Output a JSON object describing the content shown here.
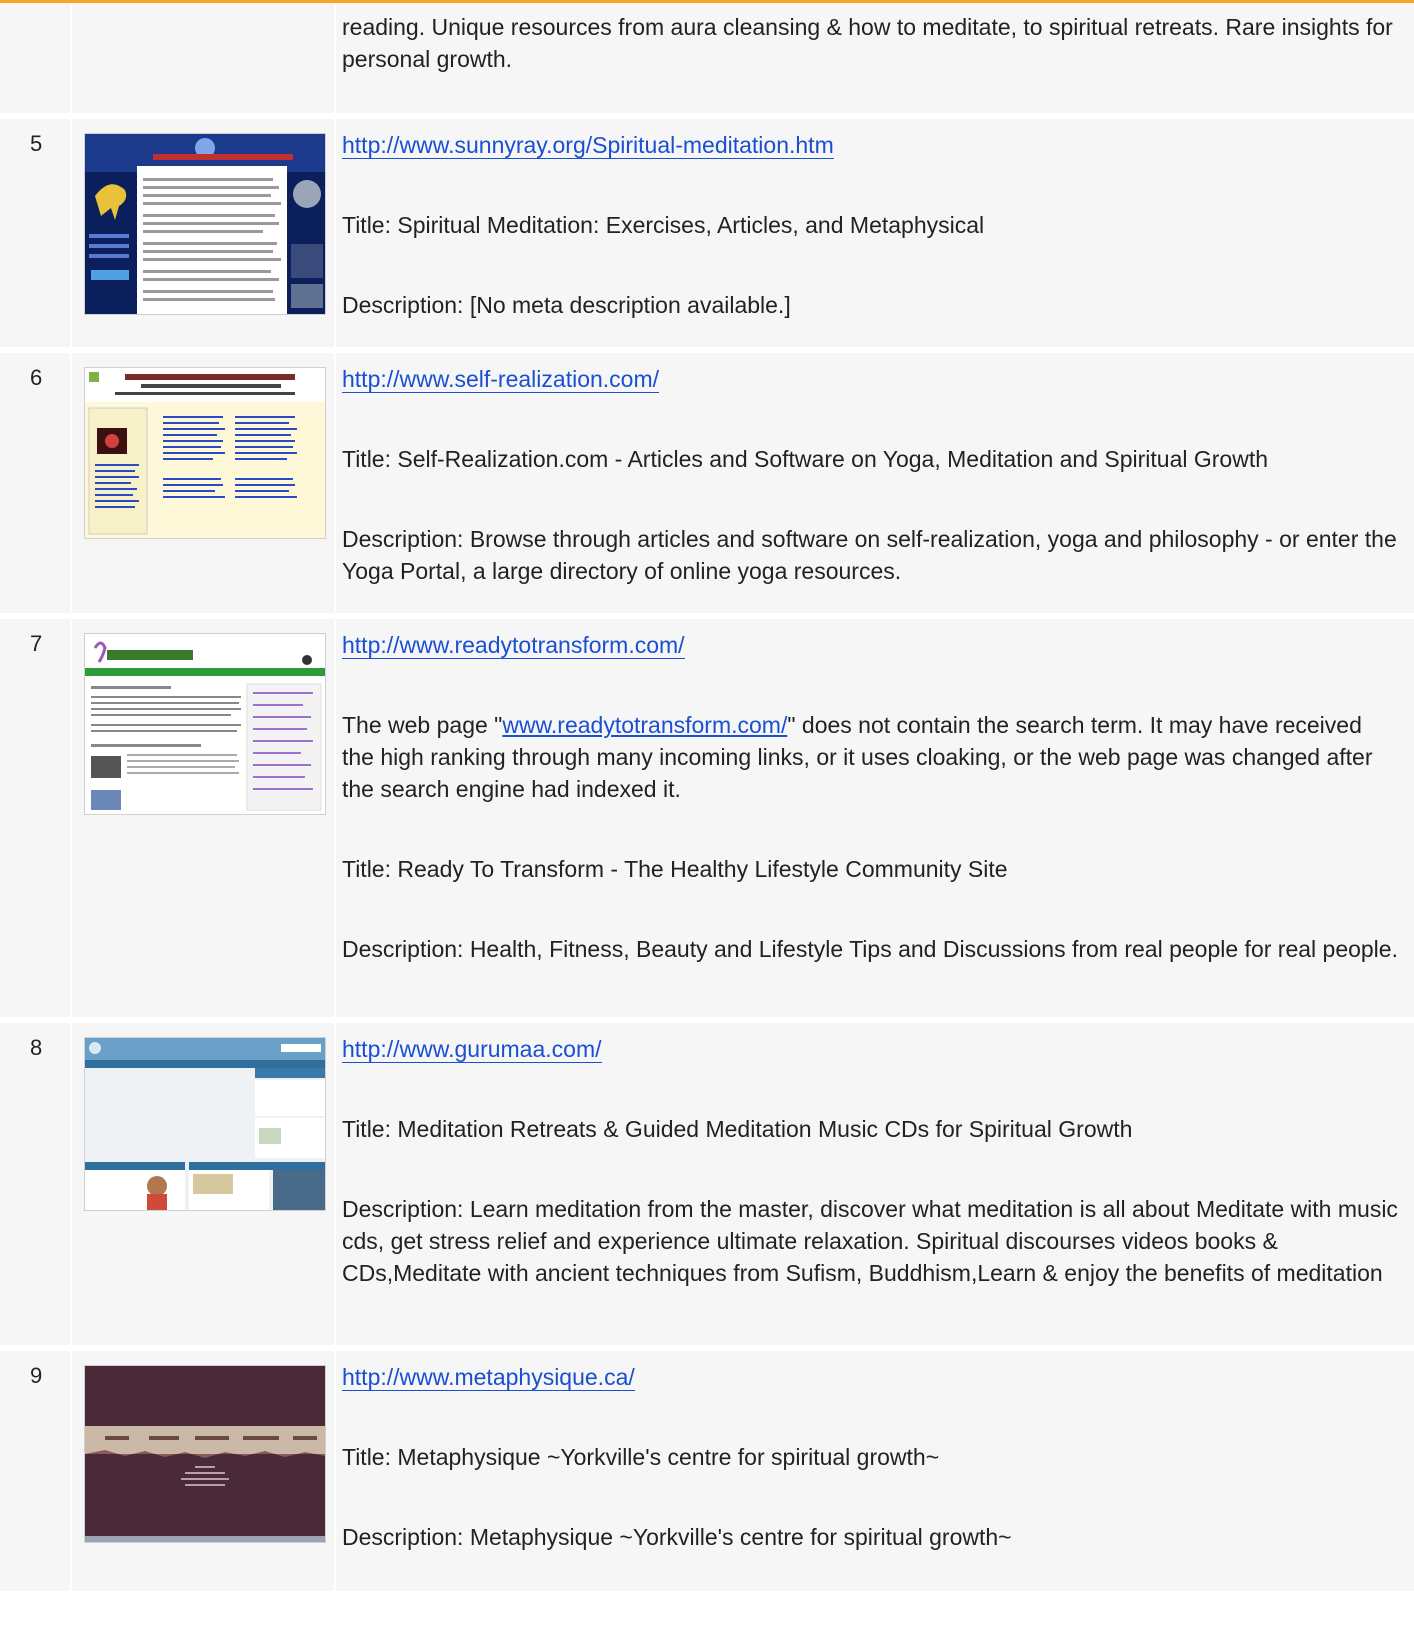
{
  "rows": [
    {
      "num": "",
      "desc": "reading. Unique resources from aura cleansing & how to meditate, to spiritual retreats. Rare insights for personal growth."
    },
    {
      "num": "5",
      "url": "http://www.sunnyray.org/Spiritual-meditation.htm",
      "title": "Title: Spiritual Meditation: Exercises, Articles, and Metaphysical",
      "desc": "Description: [No meta description available.]",
      "thumb": "sunnyray-thumbnail"
    },
    {
      "num": "6",
      "url": "http://www.self-realization.com/",
      "title": "Title: Self-Realization.com - Articles and Software on Yoga, Meditation and Spiritual Growth",
      "desc": "Description: Browse through articles and software on self-realization, yoga and philosophy - or enter the Yoga Portal, a large directory of online yoga resources.",
      "thumb": "self-realization-thumbnail"
    },
    {
      "num": "7",
      "url": "http://www.readytotransform.com/",
      "notice_pre": "The web page \"",
      "notice_link": "www.readytotransform.com/",
      "notice_post": "\" does not contain the search term. It may have received the high ranking through many incoming links, or it uses cloaking, or the web page was changed after the search engine had indexed it.",
      "title": "Title: Ready To Transform - The Healthy Lifestyle Community Site",
      "desc": "Description: Health, Fitness, Beauty and Lifestyle Tips and Discussions from real people for real people.",
      "thumb": "readytotransform-thumbnail"
    },
    {
      "num": "8",
      "url": "http://www.gurumaa.com/",
      "title": "Title: Meditation Retreats & Guided Meditation Music CDs for Spiritual Growth",
      "desc": "Description: Learn meditation from the master, discover what meditation is all about Meditate with music cds, get stress relief and experience ultimate relaxation. Spiritual discourses videos books & CDs,Meditate with ancient techniques from Sufism, Buddhism,Learn & enjoy the benefits of meditation",
      "thumb": "gurumaa-thumbnail"
    },
    {
      "num": "9",
      "url": "http://www.metaphysique.ca/",
      "title": "Title: Metaphysique ~Yorkville's centre for spiritual growth~",
      "desc": "Description: Metaphysique ~Yorkville's centre for spiritual growth~",
      "thumb": "metaphysique-thumbnail"
    }
  ],
  "colors": {
    "accent": "#f5a623",
    "link": "#1a4fd1",
    "cell_bg": "#f6f6f6"
  }
}
